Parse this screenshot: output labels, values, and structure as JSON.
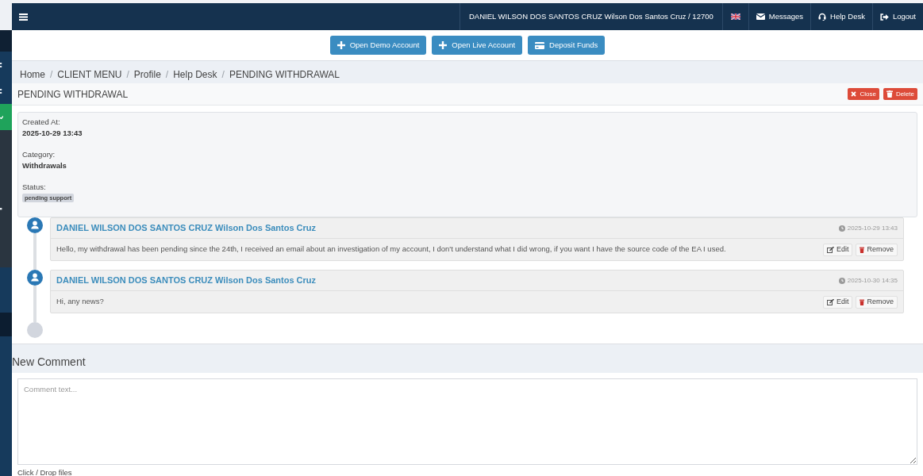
{
  "sidebar": {
    "items": [
      {
        "selected": false
      },
      {
        "selected": false
      },
      {
        "selected": true
      }
    ]
  },
  "navbar": {
    "user": "DANIEL WILSON DOS SANTOS CRUZ Wilson Dos Santos Cruz / 12700",
    "links": [
      {
        "label": "Messages"
      },
      {
        "label": "Help Desk"
      },
      {
        "label": "Logout"
      }
    ]
  },
  "actions": [
    {
      "label": "Open Demo Account"
    },
    {
      "label": "Open Live Account"
    },
    {
      "label": "Deposit Funds"
    }
  ],
  "breadcrumb": [
    {
      "label": "Home"
    },
    {
      "separator": "/",
      "label": "CLIENT MENU"
    },
    {
      "separator": "/",
      "label": "Profile"
    },
    {
      "separator": "/",
      "label": "Help Desk"
    },
    {
      "separator": "/",
      "label": "PENDING WITHDRAWAL"
    }
  ],
  "ticket": {
    "title": "PENDING WITHDRAWAL",
    "buttons": [
      {
        "label": "Close"
      },
      {
        "label": "Delete"
      }
    ],
    "details": [
      {
        "kind": "text",
        "label": "Created At:",
        "value": "2025-10-29 13:43"
      },
      {
        "kind": "text",
        "label": "Category:",
        "value": "Withdrawals"
      },
      {
        "kind": "badge",
        "label": "Status:",
        "value": "pending support"
      }
    ]
  },
  "comments": [
    {
      "author": "DANIEL WILSON DOS SANTOS CRUZ Wilson Dos Santos Cruz",
      "time": "2025-10-29 13:43",
      "text": "Hello, my withdrawal has been pending since the 24th, I received an email about an investigation of my account, I don't understand what I did wrong, if you want I have the source code of the EA I used.",
      "buttons": [
        {
          "label": "Edit"
        },
        {
          "label": "Remove"
        }
      ]
    },
    {
      "author": "DANIEL WILSON DOS SANTOS CRUZ Wilson Dos Santos Cruz",
      "time": "2025-10-30 14:35",
      "text": "Hi, any news?",
      "buttons": [
        {
          "label": "Edit"
        },
        {
          "label": "Remove"
        }
      ]
    }
  ],
  "new_comment": {
    "title": "New Comment",
    "placeholder": "Comment text...",
    "dropzone": "Click / Drop files"
  }
}
